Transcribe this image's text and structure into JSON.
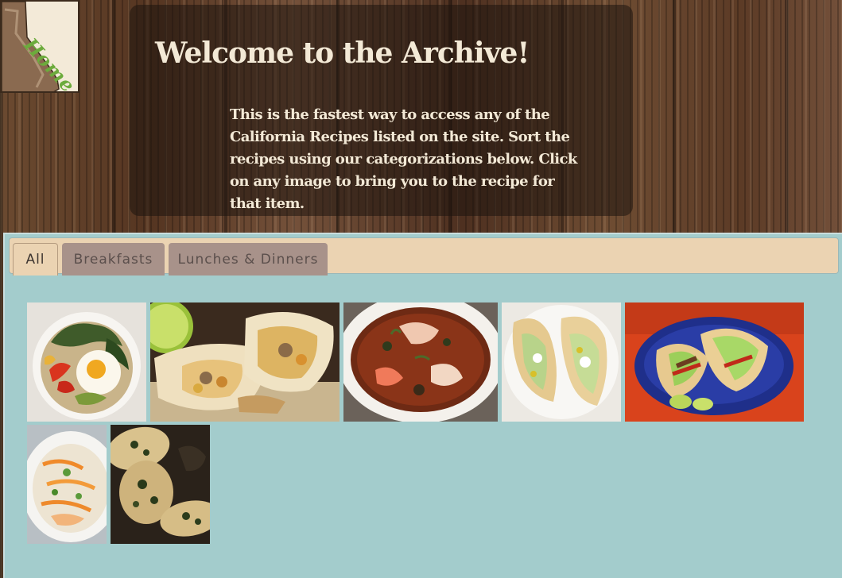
{
  "home_badge": {
    "label": "Home",
    "icon": "california-map-icon"
  },
  "welcome": {
    "title": "Welcome to the Archive!",
    "description": "This is the fastest way to access any of the California Recipes listed on the site. Sort the recipes using our categorizations below. Click on any image to bring you to the recipe for that item."
  },
  "tabs": [
    {
      "label": "All",
      "active": true
    },
    {
      "label": "Breakfasts",
      "active": false
    },
    {
      "label": "Lunches & Dinners",
      "active": false
    }
  ],
  "recipes": [
    {
      "image": "egg-kale-bowl-photo"
    },
    {
      "image": "breakfast-burrito-photo"
    },
    {
      "image": "seafood-soup-photo"
    },
    {
      "image": "fish-taco-photo"
    },
    {
      "image": "beef-tacos-blue-plate-photo"
    },
    {
      "image": "chicken-carrot-salad-photo"
    },
    {
      "image": "herb-flatbread-photo"
    }
  ],
  "colors": {
    "wood": "#5a3a24",
    "panel_text": "#f3e9d6",
    "section_bg": "#a3cccc",
    "tab_bar": "#ebd3b2",
    "tab_inactive": "#a8928a",
    "home_green": "#6cab3c"
  }
}
